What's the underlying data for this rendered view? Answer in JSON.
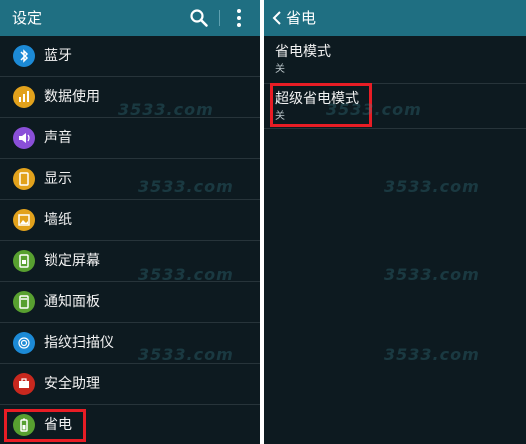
{
  "left": {
    "title": "设定",
    "items": [
      {
        "label": "蓝牙",
        "icon": "bluetooth-icon",
        "color": "#1c8ad6"
      },
      {
        "label": "数据使用",
        "icon": "data-usage-icon",
        "color": "#e2a21c"
      },
      {
        "label": "声音",
        "icon": "sound-icon",
        "color": "#8a4fd8"
      },
      {
        "label": "显示",
        "icon": "display-icon",
        "color": "#e2a21c"
      },
      {
        "label": "墙纸",
        "icon": "wallpaper-icon",
        "color": "#e2a21c"
      },
      {
        "label": "锁定屏幕",
        "icon": "lock-screen-icon",
        "color": "#58a030"
      },
      {
        "label": "通知面板",
        "icon": "notification-panel-icon",
        "color": "#58a030"
      },
      {
        "label": "指纹扫描仪",
        "icon": "fingerprint-icon",
        "color": "#1c8ad6"
      },
      {
        "label": "安全助理",
        "icon": "safety-assistance-icon",
        "color": "#c8281e"
      },
      {
        "label": "省电",
        "icon": "power-saving-icon",
        "color": "#58a030"
      }
    ]
  },
  "right": {
    "title": "省电",
    "items": [
      {
        "title": "省电模式",
        "status": "关"
      },
      {
        "title": "超级省电模式",
        "status": "关"
      }
    ]
  },
  "watermark": "3533.com",
  "colors": {
    "header": "#1f6f82",
    "background": "#0d1a20",
    "highlight": "#e81d25"
  }
}
